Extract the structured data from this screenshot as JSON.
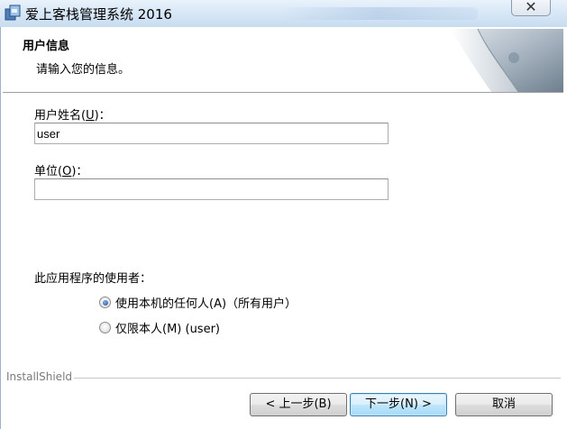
{
  "window": {
    "title": "爱上客栈管理系统 2016",
    "close_glyph": "✕"
  },
  "header": {
    "title": "用户信息",
    "subtitle": "请输入您的信息。"
  },
  "form": {
    "username_label_pre": "用户姓名(",
    "username_label_key": "U",
    "username_label_post": ")：",
    "username_value": "user",
    "org_label_pre": "单位(",
    "org_label_key": "O",
    "org_label_post": ")：",
    "org_value": "",
    "users_heading": "此应用程序的使用者：",
    "option_anyone": "使用本机的任何人(A)（所有用户）",
    "option_only_me": "仅限本人(M) (user)",
    "selected_option": "anyone"
  },
  "footer": {
    "brand": "InstallShield",
    "back_label": "< 上一步(B)",
    "next_label": "下一步(N) >",
    "cancel_label": "取消"
  },
  "colors": {
    "titlebar": "#d5e6f6",
    "primary_button": "#bee6fd",
    "radio_selected": "#1a4f9a"
  }
}
